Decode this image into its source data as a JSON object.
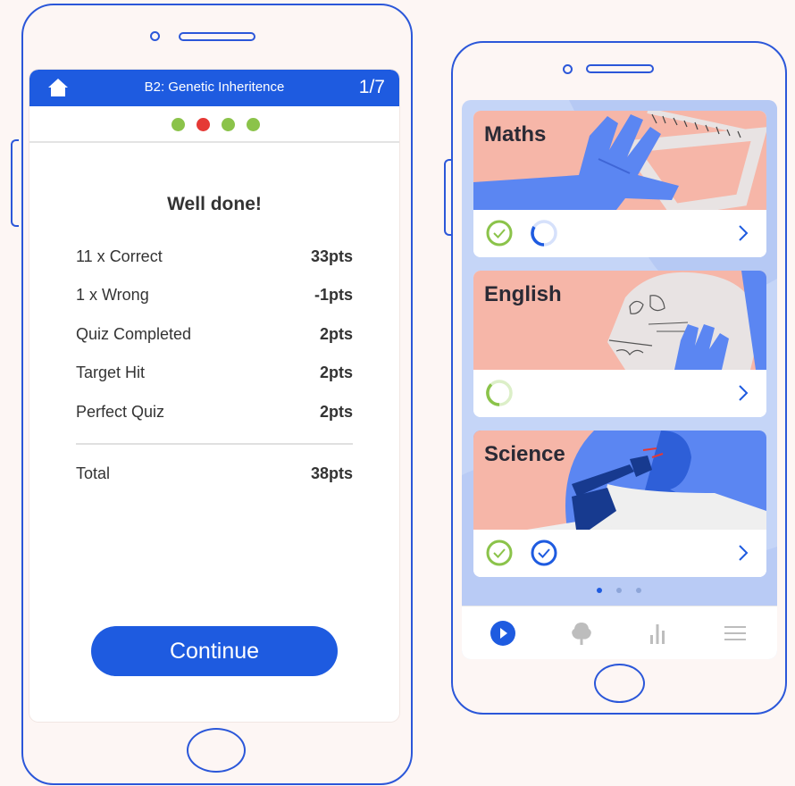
{
  "quiz": {
    "title": "B2: Genetic Inheritence",
    "progress": "1/7",
    "question_dots": [
      "#8bc34a",
      "#e53935",
      "#8bc34a",
      "#8bc34a"
    ],
    "heading": "Well done!",
    "rows": [
      {
        "label": "11 x Correct",
        "points": "33pts"
      },
      {
        "label": "1 x Wrong",
        "points": "-1pts"
      },
      {
        "label": "Quiz Completed",
        "points": "2pts"
      },
      {
        "label": "Target Hit",
        "points": "2pts"
      },
      {
        "label": "Perfect Quiz",
        "points": "2pts"
      }
    ],
    "total": {
      "label": "Total",
      "points": "38pts"
    },
    "continue_label": "Continue"
  },
  "subjects": {
    "cards": [
      {
        "name": "Maths",
        "illustration": "hand-with-set-square"
      },
      {
        "name": "English",
        "illustration": "skull-with-hand"
      },
      {
        "name": "Science",
        "illustration": "scientist-with-microscope"
      }
    ],
    "pager": {
      "pages": 3,
      "active": 1
    },
    "tabs": [
      "play-icon",
      "tree-icon",
      "bar-chart-icon",
      "menu-icon"
    ]
  },
  "colors": {
    "accent": "#1e5be0",
    "correct": "#8bc34a",
    "wrong": "#e53935",
    "card_art": "#f6b6a8",
    "illustration_blue": "#5b86f2"
  }
}
